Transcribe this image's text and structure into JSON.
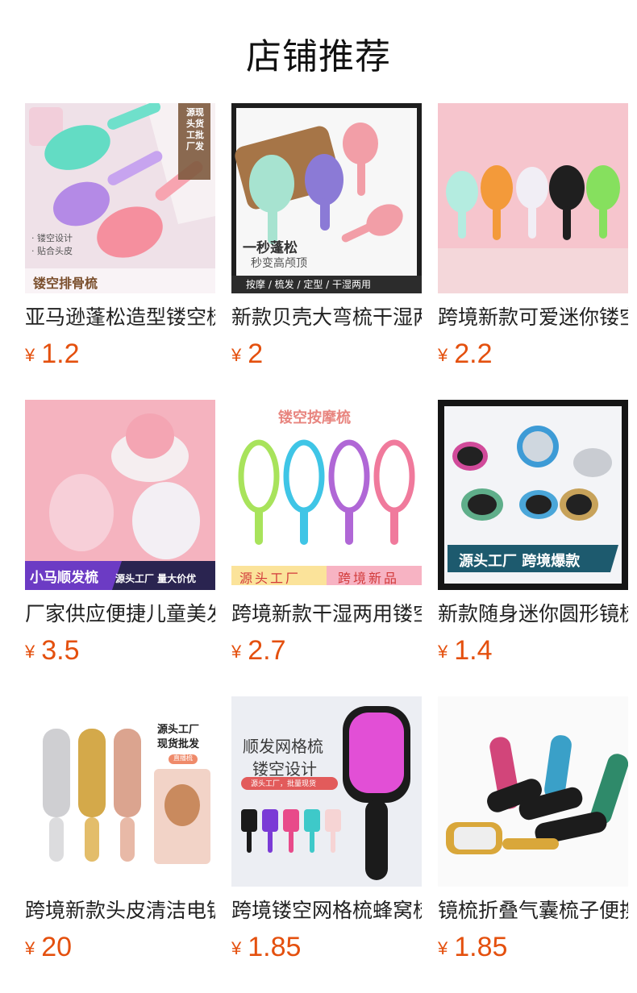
{
  "page": {
    "title": "店铺推荐",
    "currency": "¥"
  },
  "products": [
    {
      "name": "亚马逊蓬松造型镂空梳",
      "price": "1.2",
      "badge": "源现头货工批厂发",
      "caption": "镂空排骨梳",
      "notes": [
        "· 镂空设计",
        "· 贴合头皮"
      ]
    },
    {
      "name": "新款贝壳大弯梳干湿两用",
      "price": "2",
      "slogan": "一秒蓬松",
      "slogan_sub": "秒变高颅顶",
      "footer": "按摩 / 梳发 / 定型 / 干湿两用"
    },
    {
      "name": "跨境新款可爱迷你镂空梳",
      "price": "2.2"
    },
    {
      "name": "厂家供应便捷儿童美发梳",
      "price": "3.5",
      "banner_left": "小马顺发梳",
      "banner_right": "源头工厂 量大价优"
    },
    {
      "name": "跨境新款干湿两用镂空梳",
      "price": "2.7",
      "heading": "镂空按摩梳",
      "tag_left": "源头工厂",
      "tag_right": "跨境新品"
    },
    {
      "name": "新款随身迷你圆形镜梳",
      "price": "1.4",
      "banner": "源头工厂 跨境爆款"
    },
    {
      "name": "跨境新款头皮清洁电镀梳",
      "price": "20",
      "heading_1": "源头工厂",
      "heading_2": "现货批发",
      "pill": "直播梳"
    },
    {
      "name": "跨境镂空网格梳蜂窝梳",
      "price": "1.85",
      "heading_1": "顺发网格梳",
      "heading_2": "镂空设计",
      "pill": "源头工厂，批量现货"
    },
    {
      "name": "镜梳折叠气囊梳子便携",
      "price": "1.85"
    }
  ],
  "colors": {
    "price": "#e4500e",
    "title": "#111111",
    "name": "#222222"
  }
}
